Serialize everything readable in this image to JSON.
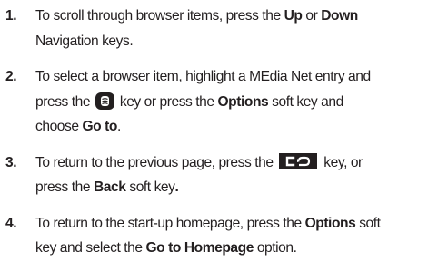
{
  "steps": [
    {
      "number": "1.",
      "t1": "To scroll through browser items, press the ",
      "b1": "Up",
      "t2": " or ",
      "b2": "Down",
      "t3": "Navigation keys."
    },
    {
      "number": "2.",
      "t1": "To select a browser item, highlight a MEdia Net entry and",
      "t2": "press the ",
      "t3": " key or press the ",
      "b1": "Options",
      "t4": " soft key and",
      "t5": "choose ",
      "b2": "Go to",
      "t6": "."
    },
    {
      "number": "3.",
      "t1": "To return to the previous page, press the ",
      "t2": " key, or",
      "t3": "press the ",
      "b1": "Back",
      "t4": " soft key",
      "b2": "."
    },
    {
      "number": "4.",
      "t1": "To return to the start-up homepage, press the ",
      "b1": "Options",
      "t2": " soft",
      "t3": "key and select the ",
      "b2": "Go to Homepage",
      "t4": " option."
    }
  ],
  "icons": {
    "center_key": "center-select-key-icon",
    "back_key": "back-key-icon",
    "key_color": "#231f20"
  }
}
